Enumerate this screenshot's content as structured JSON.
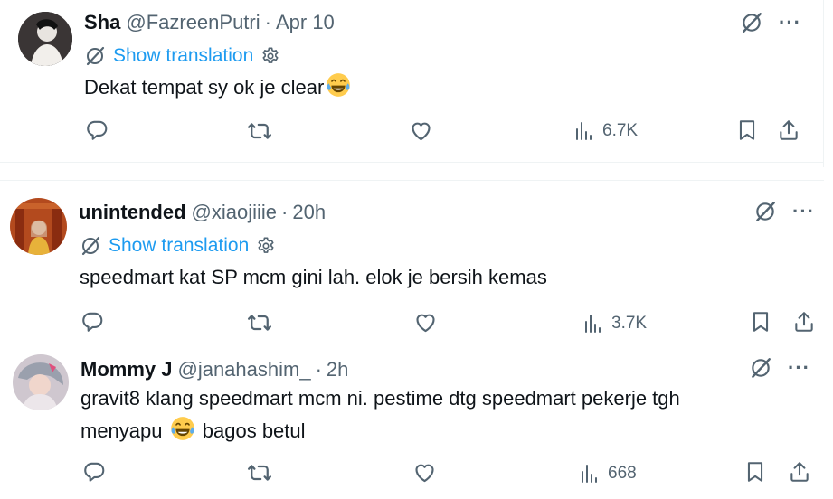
{
  "tweets": [
    {
      "name": "Sha",
      "handle": "@FazreenPutri",
      "separator": "·",
      "time": "Apr 10",
      "show_translation": "Show translation",
      "text": "Dekat tempat sy ok je clear",
      "emoji": "😂",
      "views": "6.7K",
      "avatar_icon": "user-avatar"
    },
    {
      "name": "unintended",
      "handle": "@xiaojiiie",
      "separator": "·",
      "time": "20h",
      "show_translation": "Show translation",
      "text": "speedmart kat SP mcm gini lah. elok je bersih kemas",
      "views": "3.7K",
      "avatar_icon": "user-avatar"
    },
    {
      "name": "Mommy J",
      "handle": "@janahashim_",
      "separator": "·",
      "time": "2h",
      "text_line1": "gravit8 klang speedmart mcm ni. pestime dtg speedmart pekerje tgh",
      "text_line2_a": "menyapu",
      "emoji": "😂",
      "text_line2_b": "bagos betul",
      "views": "668",
      "avatar_icon": "user-avatar"
    }
  ],
  "icons": {
    "reply": "reply-icon",
    "retweet": "retweet-icon",
    "like": "heart-icon",
    "views": "views-icon",
    "bookmark": "bookmark-icon",
    "share": "share-icon",
    "grok": "grok-icon",
    "more": "more-icon",
    "translate": "translate-icon",
    "settings": "gear-icon"
  },
  "colors": {
    "link": "#1d9bf0",
    "muted": "#536471",
    "text": "#0f1419"
  }
}
